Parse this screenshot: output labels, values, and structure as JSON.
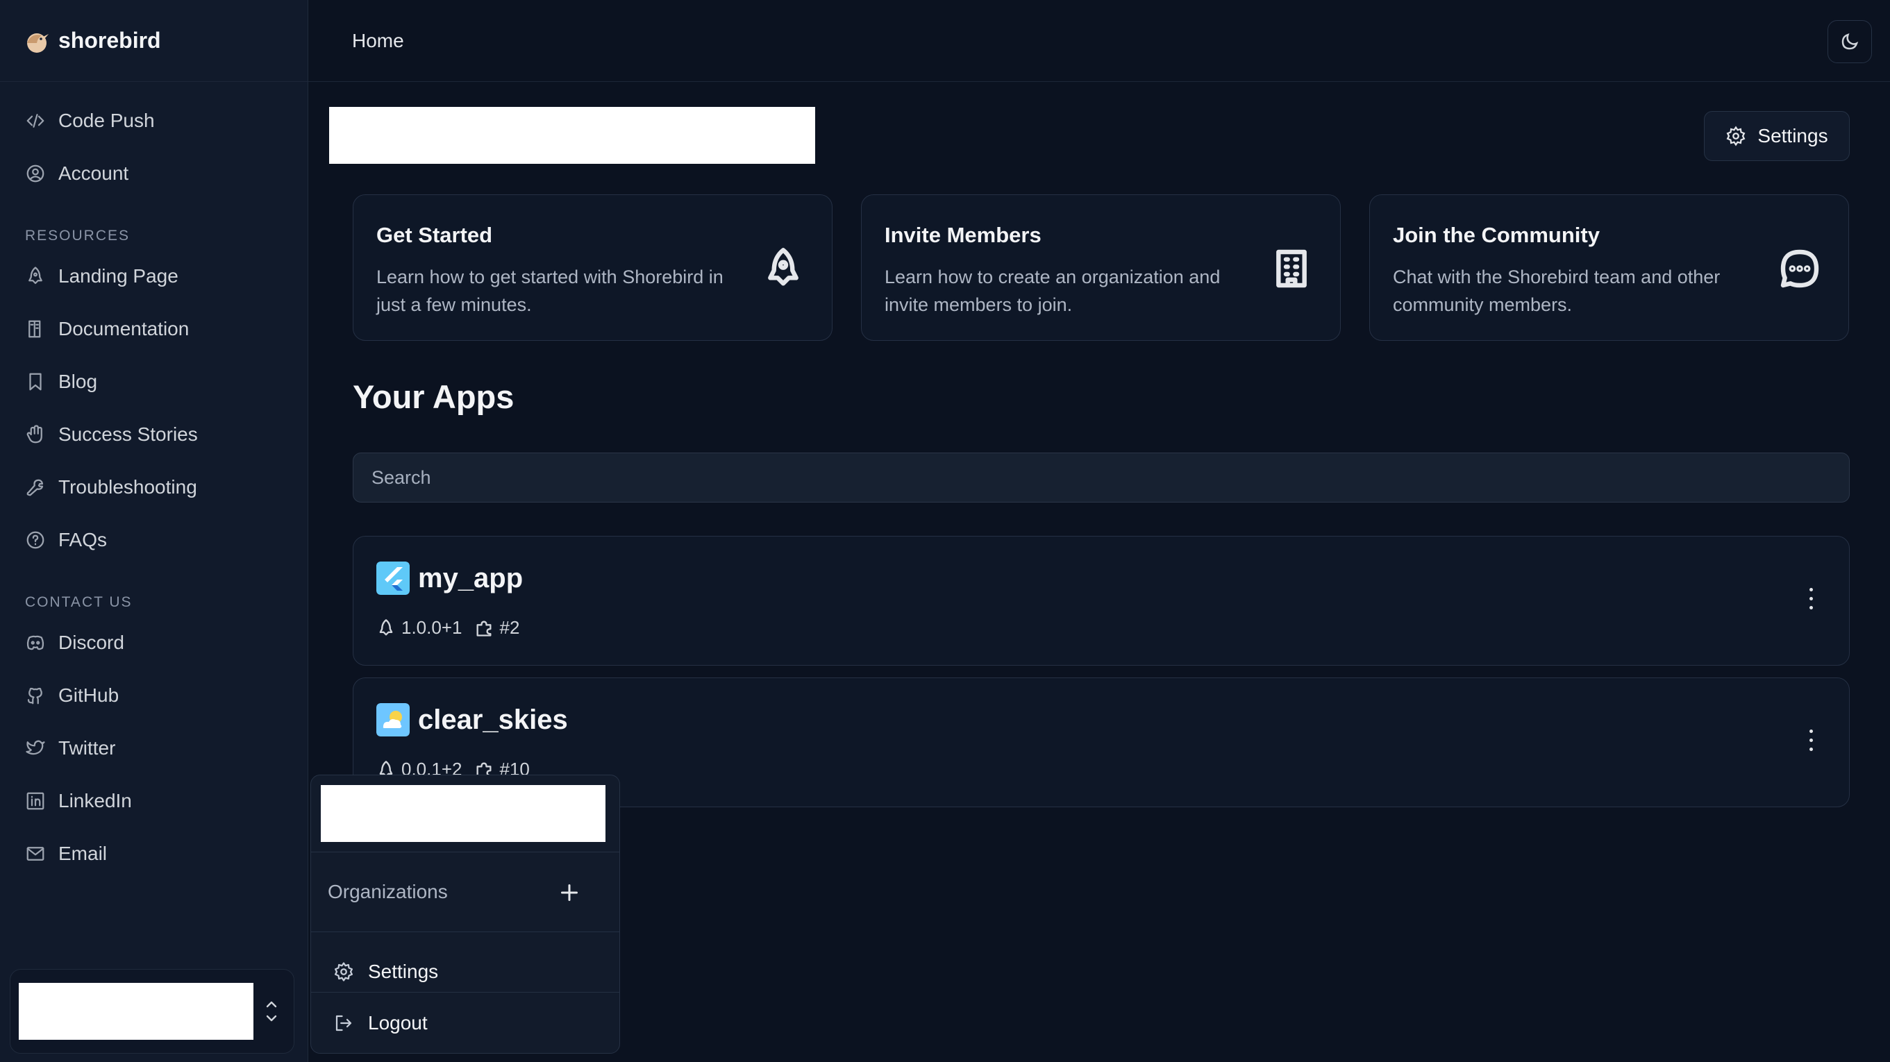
{
  "brand": {
    "name": "shorebird"
  },
  "sidebar": {
    "primary": [
      {
        "label": "Code Push",
        "icon": "code-icon"
      },
      {
        "label": "Account",
        "icon": "account-icon"
      }
    ],
    "resources_label": "RESOURCES",
    "resources": [
      {
        "label": "Landing Page",
        "icon": "rocket-icon"
      },
      {
        "label": "Documentation",
        "icon": "book-icon"
      },
      {
        "label": "Blog",
        "icon": "bookmark-icon"
      },
      {
        "label": "Success Stories",
        "icon": "hand-icon"
      },
      {
        "label": "Troubleshooting",
        "icon": "wrench-icon"
      },
      {
        "label": "FAQs",
        "icon": "question-icon"
      }
    ],
    "contact_label": "CONTACT US",
    "contact": [
      {
        "label": "Discord",
        "icon": "discord-icon"
      },
      {
        "label": "GitHub",
        "icon": "github-icon"
      },
      {
        "label": "Twitter",
        "icon": "twitter-icon"
      },
      {
        "label": "LinkedIn",
        "icon": "linkedin-icon"
      },
      {
        "label": "Email",
        "icon": "mail-icon"
      }
    ]
  },
  "header": {
    "breadcrumb": "Home",
    "theme_toggle_icon": "moon-icon"
  },
  "toolbar": {
    "settings_label": "Settings"
  },
  "cards": [
    {
      "title": "Get Started",
      "description": "Learn how to get started with Shorebird in just a few minutes.",
      "icon": "rocket-icon"
    },
    {
      "title": "Invite Members",
      "description": "Learn how to create an organization and invite members to join.",
      "icon": "building-icon"
    },
    {
      "title": "Join the Community",
      "description": "Chat with the Shorebird team and other community members.",
      "icon": "chat-icon"
    }
  ],
  "apps": {
    "title": "Your Apps",
    "search_placeholder": "Search",
    "items": [
      {
        "name": "my_app",
        "release": "1.0.0+1",
        "patch": "#2",
        "icon_colors": [
          "#5fc9f8",
          "#1f6fd1"
        ]
      },
      {
        "name": "clear_skies",
        "release": "0.0.1+2",
        "patch": "#10",
        "icon_colors": [
          "#6ec6ff",
          "#f8d34a"
        ]
      }
    ]
  },
  "user_menu": {
    "organizations_label": "Organizations",
    "settings_label": "Settings",
    "logout_label": "Logout"
  },
  "colors": {
    "background": "#0b1220",
    "sidebar": "#111a2b",
    "card": "#0e1727",
    "border": "#253044"
  }
}
